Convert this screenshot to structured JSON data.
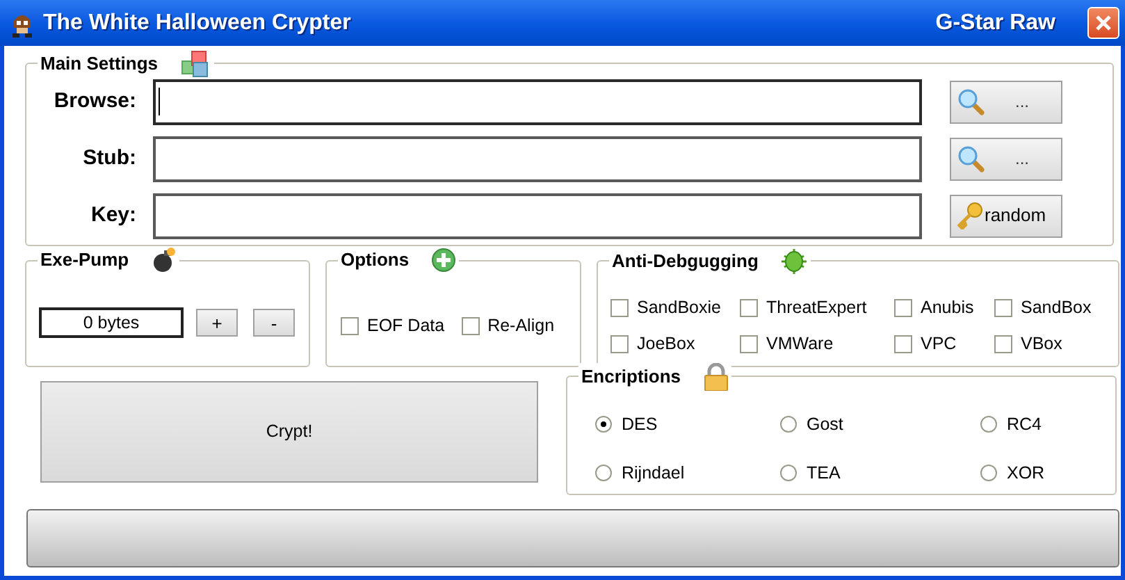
{
  "window": {
    "title": "The White Halloween Crypter",
    "subtitle": "G-Star Raw"
  },
  "main_settings": {
    "title": "Main Settings",
    "fields": [
      {
        "label": "Browse:",
        "focused": true,
        "button": {
          "kind": "browse",
          "label": "..."
        }
      },
      {
        "label": "Stub:",
        "focused": false,
        "button": {
          "kind": "browse",
          "label": "..."
        }
      },
      {
        "label": "Key:",
        "focused": false,
        "button": {
          "kind": "random",
          "label": "random"
        }
      }
    ]
  },
  "exe_pump": {
    "title": "Exe-Pump",
    "value": "0 bytes",
    "buttons": [
      "+",
      "-"
    ]
  },
  "options": {
    "title": "Options",
    "checkboxes": [
      {
        "label": "EOF Data",
        "checked": false
      },
      {
        "label": "Re-Align",
        "checked": false
      }
    ]
  },
  "anti_debugging": {
    "title": "Anti-Debgugging",
    "checkboxes": [
      {
        "label": "SandBoxie",
        "checked": false
      },
      {
        "label": "ThreatExpert",
        "checked": false
      },
      {
        "label": "Anubis",
        "checked": false
      },
      {
        "label": "SandBox",
        "checked": false
      },
      {
        "label": "JoeBox",
        "checked": false
      },
      {
        "label": "VMWare",
        "checked": false
      },
      {
        "label": "VPC",
        "checked": false
      },
      {
        "label": "VBox",
        "checked": false
      }
    ]
  },
  "crypt_button": "Crypt!",
  "encryptions": {
    "title": "Encriptions",
    "options": [
      {
        "label": "DES",
        "selected": true
      },
      {
        "label": "Gost",
        "selected": false
      },
      {
        "label": "RC4",
        "selected": false
      },
      {
        "label": "Rijndael",
        "selected": false
      },
      {
        "label": "TEA",
        "selected": false
      },
      {
        "label": "XOR",
        "selected": false
      }
    ]
  },
  "progress": {
    "level": 0
  }
}
